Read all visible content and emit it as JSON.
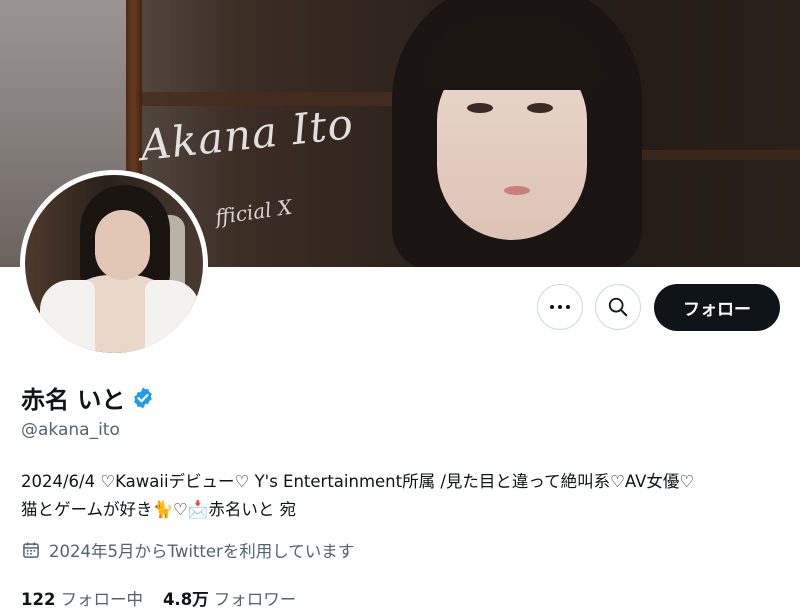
{
  "banner": {
    "signature_main": "Akana Ito",
    "signature_sub": "fficial X"
  },
  "actions": {
    "more_icon": "more-horizontal-icon",
    "search_icon": "search-icon",
    "follow_label": "フォロー"
  },
  "profile": {
    "display_name": "赤名 いと",
    "verified_icon": "verified-badge-icon",
    "verified_color": "#1d9bf0",
    "handle": "@akana_ito",
    "bio_line1": "2024/6/4 ♡Kawaiiデビュー♡ Y's Entertainment所属 /見た目と違って絶叫系♡AV女優♡",
    "bio_line2": "猫とゲームが好き🐈♡📩赤名いと 宛",
    "joined_icon": "calendar-icon",
    "joined_text": "2024年5月からTwitterを利用しています"
  },
  "stats": {
    "following_count": "122",
    "following_label": "フォロー中",
    "followers_count": "4.8万",
    "followers_label": "フォロワー"
  }
}
